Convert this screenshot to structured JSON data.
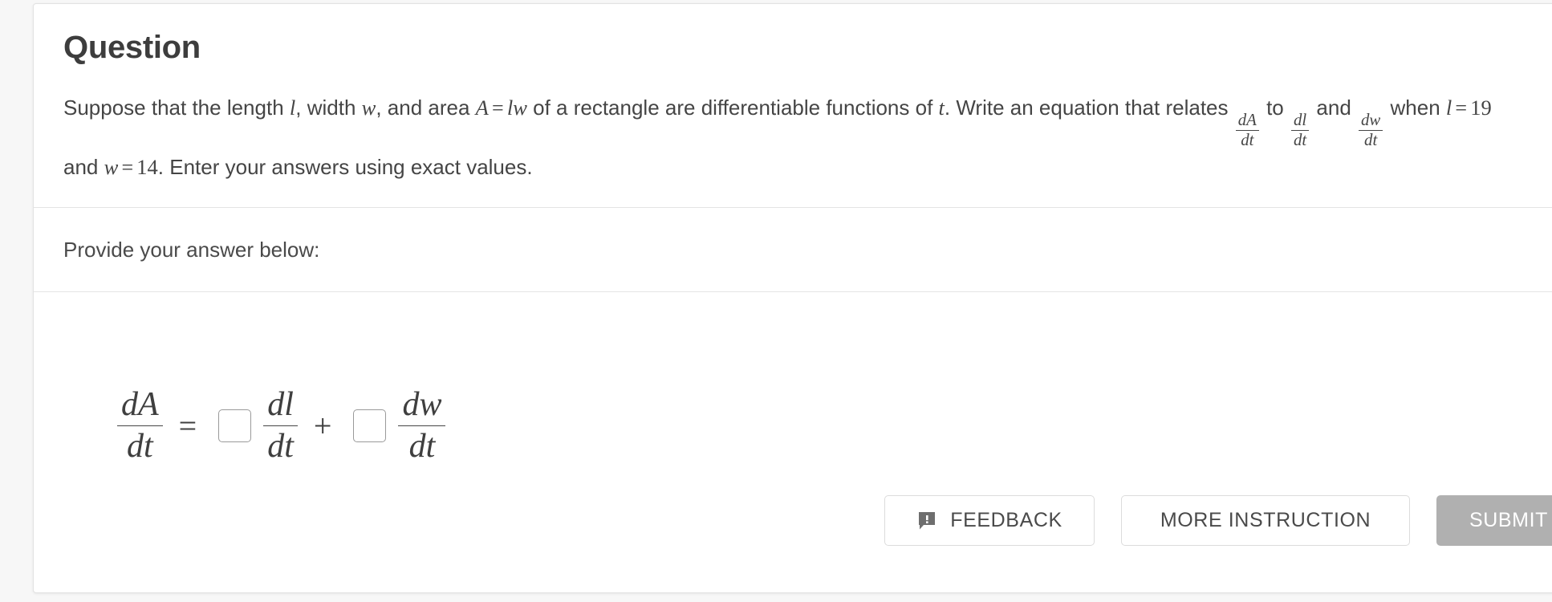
{
  "card": {
    "title": "Question",
    "question": {
      "line1_pre": "Suppose that the length ",
      "var_l": "l",
      "line1_mid1": ", width ",
      "var_w": "w",
      "line1_mid2": ", and area ",
      "area_A": "A",
      "equals": "=",
      "area_lw": "lw",
      "line1_mid3": " of a rectangle are differentiable functions of ",
      "var_t": "t",
      "line1_end": ". Write an equation that relates ",
      "frac_dA_dt": {
        "num": "dA",
        "den": "dt"
      },
      "to": " to ",
      "frac_dl_dt": {
        "num": "dl",
        "den": "dt"
      },
      "and": " and ",
      "frac_dw_dt": {
        "num": "dw",
        "den": "dt"
      },
      "when": " when ",
      "l_eq": "l",
      "l_val": "19",
      "and2": " and ",
      "w_eq": "w",
      "w_val": "14",
      "tail": ". Enter your answers using exact values."
    },
    "provide_label": "Provide your answer below:",
    "answer": {
      "lhs": {
        "num": "dA",
        "den": "dt"
      },
      "equals": "=",
      "box1_value": "",
      "box1_placeholder": "",
      "term1": {
        "num": "dl",
        "den": "dt"
      },
      "plus": "+",
      "box2_value": "",
      "box2_placeholder": "",
      "term2": {
        "num": "dw",
        "den": "dt"
      }
    },
    "buttons": {
      "feedback": "FEEDBACK",
      "more_instruction": "MORE INSTRUCTION",
      "submit": "SUBMIT"
    },
    "icons": {
      "feedback": "feedback-speech-bubble-icon"
    },
    "colors": {
      "card_background": "#ffffff",
      "page_background": "#f7f7f7",
      "border": "#e2e2e2",
      "divider": "#e4e4e4",
      "text": "#454545",
      "title": "#3d3d3d",
      "submit_fill": "#b0b0b0",
      "submit_text": "#ffffff",
      "input_border": "#9a9a9a",
      "icon_fill": "#6e6e6e"
    }
  }
}
